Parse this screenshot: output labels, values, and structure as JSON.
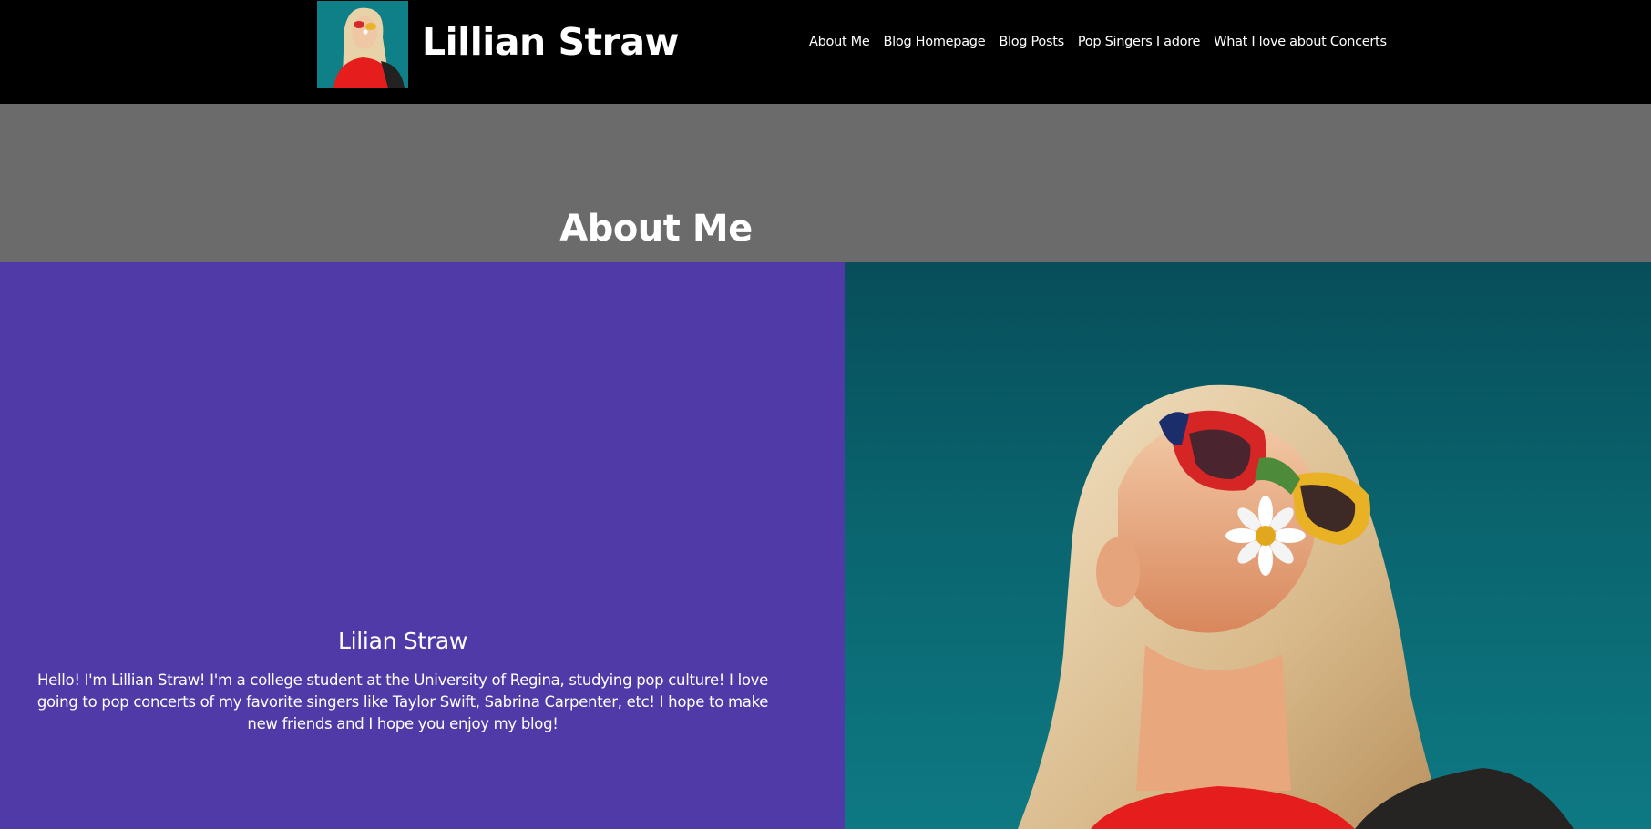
{
  "header": {
    "site_title": "Lillian Straw",
    "nav": [
      {
        "label": "About Me"
      },
      {
        "label": "Blog Homepage"
      },
      {
        "label": "Blog Posts"
      },
      {
        "label": "Pop Singers I adore"
      },
      {
        "label": "What I love about Concerts"
      }
    ]
  },
  "hero": {
    "title": "About Me"
  },
  "bio": {
    "name": "Lilian Straw",
    "text": "Hello! I'm Lillian Straw! I'm a college student at the University of Regina, studying pop culture! I love going to pop concerts of my favorite singers like Taylor Swift, Sabrina Carpenter, etc! I hope to make new friends and I hope you enjoy my blog!"
  },
  "colors": {
    "header_bg": "#000000",
    "hero_bg": "#6b6b6b",
    "bio_bg": "#4f3aa7",
    "photo_bg": "#0b6b74"
  }
}
